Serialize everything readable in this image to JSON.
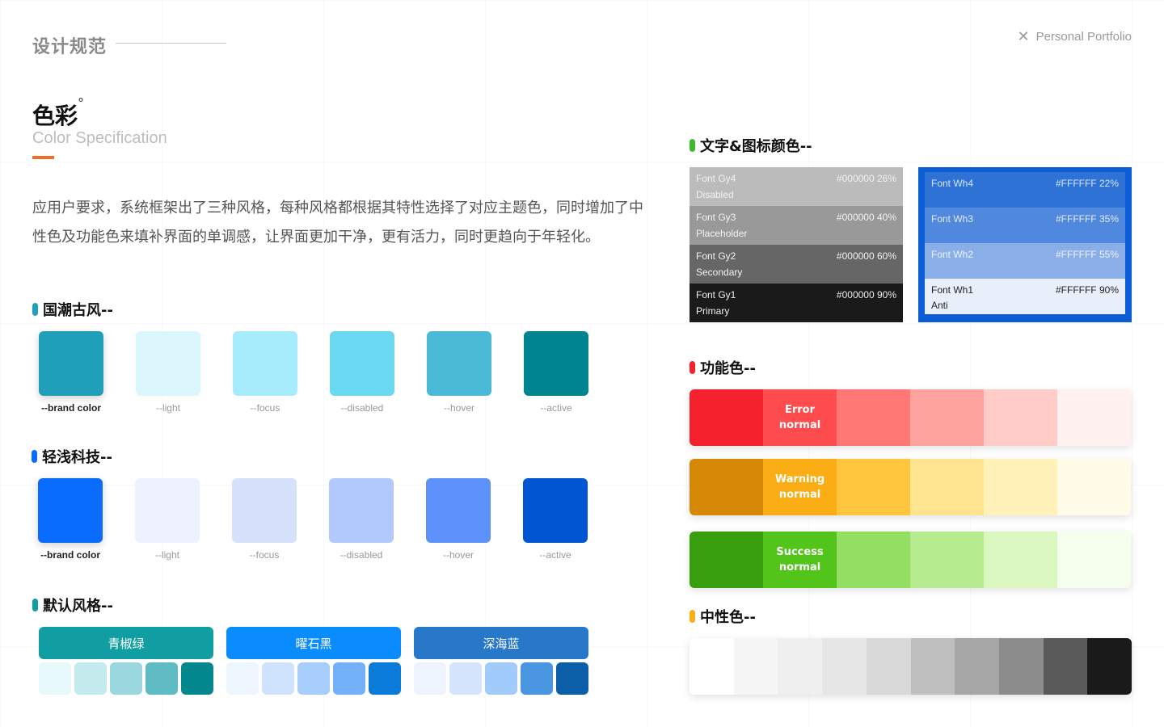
{
  "header": {
    "brand_title": "设计规范",
    "portfolio_label": "Personal Portfolio",
    "close_glyph": "✕"
  },
  "section": {
    "title": "色彩",
    "title_mark": "°",
    "subtitle": "Color Specification",
    "intro": "应用户要求，系统框架出了三种风格，每种风格都根据其特性选择了对应主题色，同时增加了中性色及功能色来填补界面的单调感，让界面更加干净，更有活力，同时更趋向于年轻化。"
  },
  "groups": {
    "guochao": {
      "title": "国潮古风--",
      "tick_color": "#1f9fb8",
      "swatches": [
        {
          "label": "--brand color",
          "color": "#1f9fb8"
        },
        {
          "label": "--light",
          "color": "#dbf6fc"
        },
        {
          "label": "--focus",
          "color": "#a7ecfb"
        },
        {
          "label": "--disabled",
          "color": "#6bd9f2"
        },
        {
          "label": "--hover",
          "color": "#4ab9d6"
        },
        {
          "label": "--active",
          "color": "#00848f"
        }
      ]
    },
    "qingqian": {
      "title": "轻浅科技--",
      "tick_color": "#0a6cff",
      "swatches": [
        {
          "label": "--brand color",
          "color": "#0a6cff"
        },
        {
          "label": "--light",
          "color": "#eef2fe"
        },
        {
          "label": "--focus",
          "color": "#d6e2fc"
        },
        {
          "label": "--disabled",
          "color": "#b1c9fd"
        },
        {
          "label": "--hover",
          "color": "#5e92fb"
        },
        {
          "label": "--active",
          "color": "#0055d2"
        }
      ]
    },
    "default": {
      "title": "默认风格--",
      "tick_color": "#119ea2",
      "themes": [
        {
          "name": "青椒绿",
          "color": "#119ea2",
          "swatches": [
            "#e8f9fb",
            "#c3ebed",
            "#9bd7de",
            "#5fbcc2",
            "#048890"
          ]
        },
        {
          "name": "曜石黑",
          "color": "#0a8cff",
          "swatches": [
            "#eef6ff",
            "#d0e5fd",
            "#a7cdfc",
            "#72b1f9",
            "#0a7bd9"
          ]
        },
        {
          "name": "深海蓝",
          "color": "#2778c8",
          "swatches": [
            "#eef4fd",
            "#d3e5fd",
            "#a0cbfb",
            "#4b96e0",
            "#0b5ea8"
          ]
        }
      ]
    }
  },
  "text_icon_colors": {
    "title": "文字&图标颜色--",
    "tick_color": "#3db830",
    "dark_panel": [
      {
        "name": "Font Gy4",
        "desc": "Disabled",
        "hex": "#000000 26%",
        "bg": "#bbbbbb",
        "fg": "#f2f2f2"
      },
      {
        "name": "Font Gy3",
        "desc": "Placeholder",
        "hex": "#000000 40%",
        "bg": "#999999",
        "fg": "#f2f2f2"
      },
      {
        "name": "Font Gy2",
        "desc": "Secondary",
        "hex": "#000000 60%",
        "bg": "#666666",
        "fg": "#f2f2f2"
      },
      {
        "name": "Font Gy1",
        "desc": "Primary",
        "hex": "#000000 90%",
        "bg": "#1a1a1a",
        "fg": "#eeeeee"
      }
    ],
    "light_panel": [
      {
        "name": "Font Wh4",
        "desc": "",
        "hex": "#FFFFFF 22%",
        "bg": "#2f72d6",
        "fg": "#d8e6fa"
      },
      {
        "name": "Font Wh3",
        "desc": "",
        "hex": "#FFFFFF 35%",
        "bg": "#4f88dd",
        "fg": "#e2ecfb"
      },
      {
        "name": "Font Wh2",
        "desc": "",
        "hex": "#FFFFFF 55%",
        "bg": "#8aaee8",
        "fg": "#eef3fc"
      },
      {
        "name": "Font Wh1",
        "desc": "Anti",
        "hex": "#FFFFFF 90%",
        "bg": "#e8effb",
        "fg": "#222222"
      }
    ]
  },
  "function_colors": {
    "title": "功能色--",
    "tick_color": "#f5222d",
    "rows": [
      {
        "label_1": "Error",
        "label_2": "normal",
        "cells": [
          "#f5222d",
          "#ff4d4f",
          "#ff7875",
          "#ffa39e",
          "#ffccc7",
          "#fff1f0"
        ]
      },
      {
        "label_1": "Warning",
        "label_2": "normal",
        "cells": [
          "#d48806",
          "#faad14",
          "#ffc53d",
          "#ffe58f",
          "#fff1b8",
          "#fffbe6"
        ]
      },
      {
        "label_1": "Success",
        "label_2": "normal",
        "cells": [
          "#389e0d",
          "#52c41a",
          "#95de64",
          "#b7eb8f",
          "#d9f7be",
          "#f6ffed"
        ]
      }
    ]
  },
  "neutral_colors": {
    "title": "中性色--",
    "tick_color": "#faad14",
    "cells": [
      "#ffffff",
      "#f5f5f5",
      "#efefef",
      "#e6e6e6",
      "#d9d9d9",
      "#bfbfbf",
      "#a6a6a6",
      "#8c8c8c",
      "#595959",
      "#1a1a1a"
    ]
  }
}
